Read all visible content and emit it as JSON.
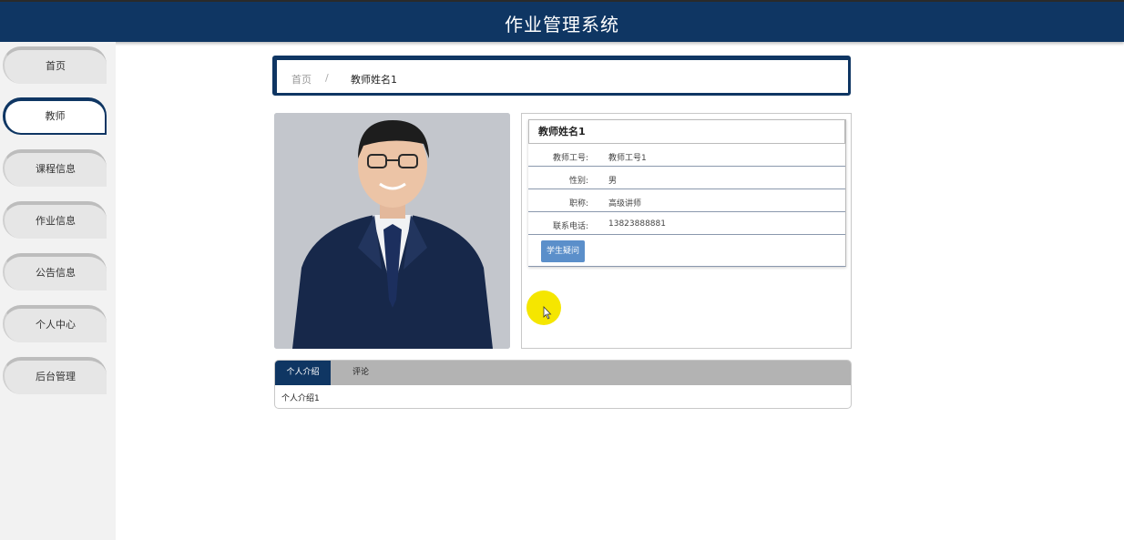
{
  "header": {
    "title": "作业管理系统"
  },
  "sidebar": {
    "items": [
      {
        "label": "首页"
      },
      {
        "label": "教师"
      },
      {
        "label": "课程信息"
      },
      {
        "label": "作业信息"
      },
      {
        "label": "公告信息"
      },
      {
        "label": "个人中心"
      },
      {
        "label": "后台管理"
      }
    ],
    "active": "教师"
  },
  "breadcrumb": {
    "home": "首页",
    "separator": "/",
    "current": "教师姓名1"
  },
  "teacher": {
    "name": "教师姓名1",
    "fields": [
      {
        "label": "教师工号:",
        "value": "教师工号1"
      },
      {
        "label": "性别:",
        "value": "男"
      },
      {
        "label": "职称:",
        "value": "高级讲师"
      },
      {
        "label": "联系电话:",
        "value": "13823888881"
      }
    ],
    "ask_button": "学生疑问"
  },
  "tabs": {
    "items": [
      {
        "label": "个人介绍"
      },
      {
        "label": "评论"
      }
    ],
    "active": "个人介绍",
    "content": "个人介绍1"
  },
  "colors": {
    "primary": "#0f3663",
    "button": "#5b8fca",
    "tab_bar": "#b3b3b3",
    "sidebar_bg": "#f2f2f2"
  }
}
